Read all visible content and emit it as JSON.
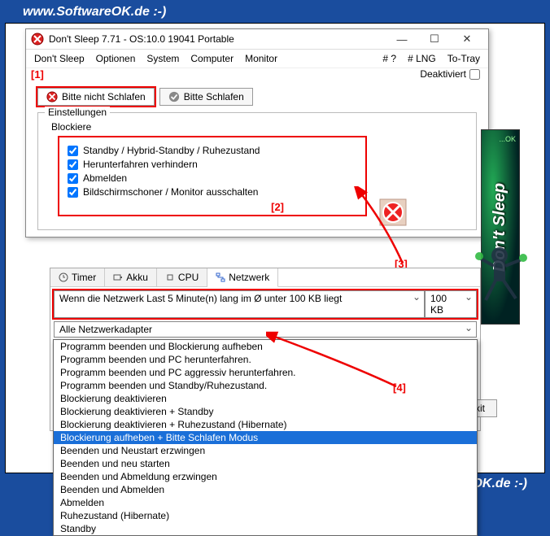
{
  "watermark": "www.SoftwareOK.de :-)",
  "window": {
    "title": "Don't Sleep 7.71 - OS:10.0 19041 Portable",
    "minimize": "—",
    "maximize": "☐",
    "close": "✕"
  },
  "menu": {
    "dont_sleep": "Don't Sleep",
    "optionen": "Optionen",
    "system": "System",
    "computer": "Computer",
    "monitor": "Monitor",
    "hash": "# ?",
    "lng": "# LNG",
    "totray": "To-Tray"
  },
  "deaktiviert": "Deaktiviert",
  "annotations": {
    "a1": "[1]",
    "a2": "[2]",
    "a3": "[3]",
    "a4": "[4]"
  },
  "tabs": {
    "bitte_nicht": "Bitte nicht Schlafen",
    "bitte": "Bitte Schlafen"
  },
  "group": {
    "einstellungen": "Einstellungen",
    "blockiere": "Blockiere",
    "items": [
      "Standby / Hybrid-Standby / Ruhezustand",
      "Herunterfahren verhindern",
      "Abmelden",
      "Bildschirmschoner / Monitor ausschalten"
    ]
  },
  "lower_tabs": {
    "timer": "Timer",
    "akku": "Akku",
    "cpu": "CPU",
    "netzwerk": "Netzwerk"
  },
  "network": {
    "rule": "Wenn die Netzwerk Last 5 Minute(n) lang im Ø unter 100 KB liegt",
    "size": "100 KB",
    "adapter": "Alle Netzwerkadapter",
    "selected": "Blockierung aufheben + Bitte Schlafen Modus"
  },
  "dropdown_items": [
    "Programm beenden und Blockierung aufheben",
    "Programm beenden und PC herunterfahren.",
    "Programm beenden und PC aggressiv herunterfahren.",
    "Programm beenden und Standby/Ruhezustand.",
    "Blockierung deaktivieren",
    "Blockierung deaktivieren + Standby",
    "Blockierung deaktivieren + Ruhezustand (Hibernate)",
    "Blockierung aufheben + Bitte Schlafen Modus",
    "Beenden und Neustart erzwingen",
    "Beenden und neu starten",
    "Beenden und Abmeldung erzwingen",
    "Beenden und Abmelden",
    "Abmelden",
    "Ruhezustand (Hibernate)",
    "Standby"
  ],
  "dropdown_selected_index": 7,
  "exit": "Exit",
  "sidelogo": "Don't Sleep",
  "sidelogo_ok": "...OK"
}
